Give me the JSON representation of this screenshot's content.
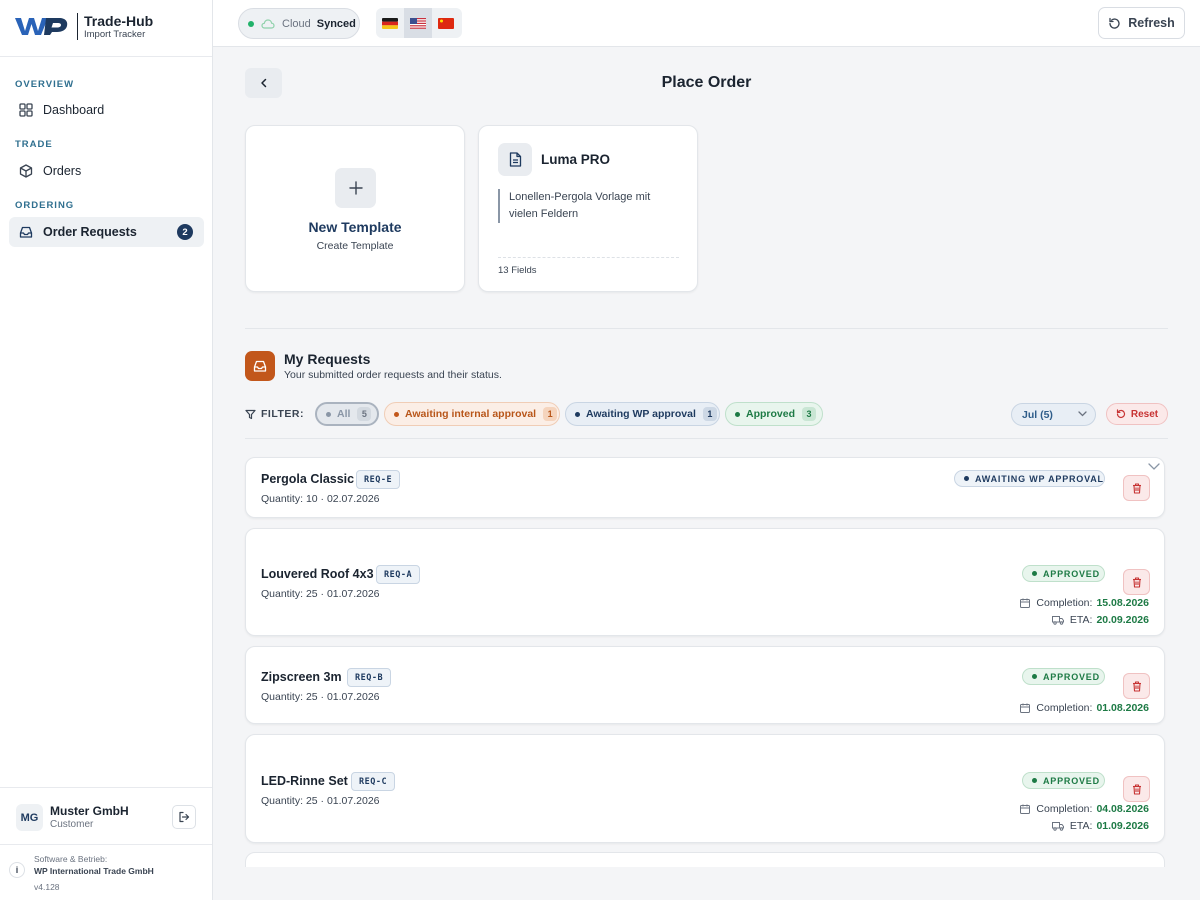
{
  "brand": {
    "name": "Trade-Hub",
    "subtitle": "Import Tracker"
  },
  "sidebar": {
    "sections": [
      {
        "label": "OVERVIEW",
        "items": [
          {
            "label": "Dashboard",
            "icon": "grid-icon"
          }
        ]
      },
      {
        "label": "TRADE",
        "items": [
          {
            "label": "Orders",
            "icon": "box-icon"
          }
        ]
      },
      {
        "label": "ORDERING",
        "items": [
          {
            "label": "Order Requests",
            "icon": "inbox-icon",
            "badge": "2",
            "active": true
          }
        ]
      }
    ],
    "user": {
      "initials": "MG",
      "name": "Muster GmbH",
      "role": "Customer"
    },
    "footer": {
      "line1": "Software & Betrieb:",
      "line2": "WP International Trade GmbH",
      "version": "v4.128"
    }
  },
  "header": {
    "cloud_label": "Cloud",
    "cloud_status": "Synced",
    "languages": [
      {
        "code": "de",
        "flag": "german-flag-icon"
      },
      {
        "code": "en",
        "flag": "us-flag-icon",
        "active": true
      },
      {
        "code": "zh",
        "flag": "china-flag-icon"
      }
    ],
    "refresh_label": "Refresh"
  },
  "main": {
    "title": "Place Order",
    "new_template": {
      "title": "New Template",
      "subtitle": "Create Template"
    },
    "template": {
      "title": "Luma PRO",
      "description": "Lonellen-Pergola Vorlage mit vielen Feldern",
      "fields": "13 Fields"
    },
    "requests": {
      "title": "My Requests",
      "subtitle": "Your submitted order requests and their status.",
      "filter_label": "FILTER:",
      "filters": [
        {
          "label": "All",
          "count": "5"
        },
        {
          "label": "Awaiting internal approval",
          "count": "1"
        },
        {
          "label": "Awaiting WP approval",
          "count": "1"
        },
        {
          "label": "Approved",
          "count": "3"
        }
      ],
      "month": "Jul (5)",
      "reset_label": "Reset",
      "items": [
        {
          "name": "Pergola Classic",
          "id": "REQ-E",
          "meta": "Quantity: 10 · 02.07.2026",
          "status": "AWAITING WP APPROVAL"
        },
        {
          "name": "Louvered Roof 4x3",
          "id": "REQ-A",
          "meta": "Quantity: 25 · 01.07.2026",
          "status": "APPROVED",
          "completion_label": "Completion:",
          "completion": "15.08.2026",
          "eta_label": "ETA:",
          "eta": "20.09.2026"
        },
        {
          "name": "Zipscreen 3m",
          "id": "REQ-B",
          "meta": "Quantity: 25 · 01.07.2026",
          "status": "APPROVED",
          "completion_label": "Completion:",
          "completion": "01.08.2026"
        },
        {
          "name": "LED-Rinne Set",
          "id": "REQ-C",
          "meta": "Quantity: 25 · 01.07.2026",
          "status": "APPROVED",
          "completion_label": "Completion:",
          "completion": "04.08.2026",
          "eta_label": "ETA:",
          "eta": "01.09.2026"
        }
      ]
    }
  },
  "colors": {
    "accent": "#1e3a5f",
    "orange": "#c2571b",
    "green": "#1d7a45",
    "danger": "#c73333"
  }
}
